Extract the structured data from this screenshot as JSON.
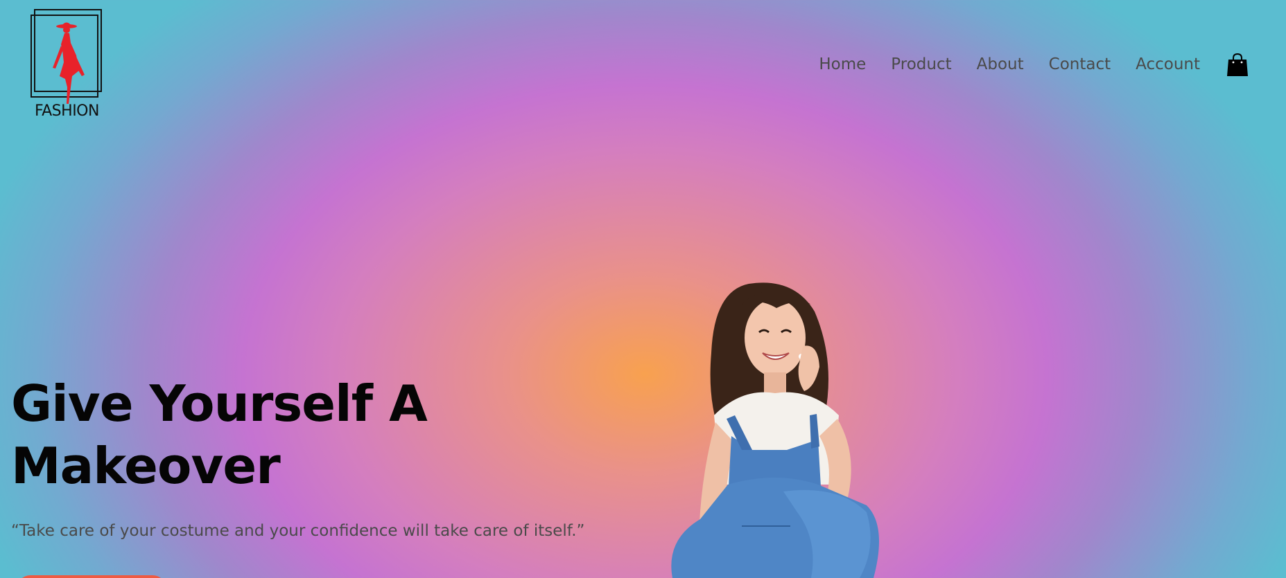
{
  "logo": {
    "text": "FASHION",
    "icon": "fashion-woman-silhouette",
    "accent_color": "#e8222a"
  },
  "nav": {
    "items": [
      {
        "label": "Home"
      },
      {
        "label": "Product"
      },
      {
        "label": "About"
      },
      {
        "label": "Contact"
      },
      {
        "label": "Account"
      }
    ],
    "cart_icon": "shopping-bag-icon"
  },
  "hero": {
    "title_line1": "Give Yourself A",
    "title_line2": "Makeover",
    "quote": "“Take care of your costume and your confidence will take care of itself.”",
    "cta_color": "#ef5b43",
    "image": "smiling-woman-in-denim-overalls"
  },
  "colors": {
    "gradient_center": "#f8a14f",
    "gradient_mid": "#c573d1",
    "gradient_edge": "#5bbdd0",
    "text_dark": "#050505",
    "text_muted": "#4a4a4a"
  }
}
